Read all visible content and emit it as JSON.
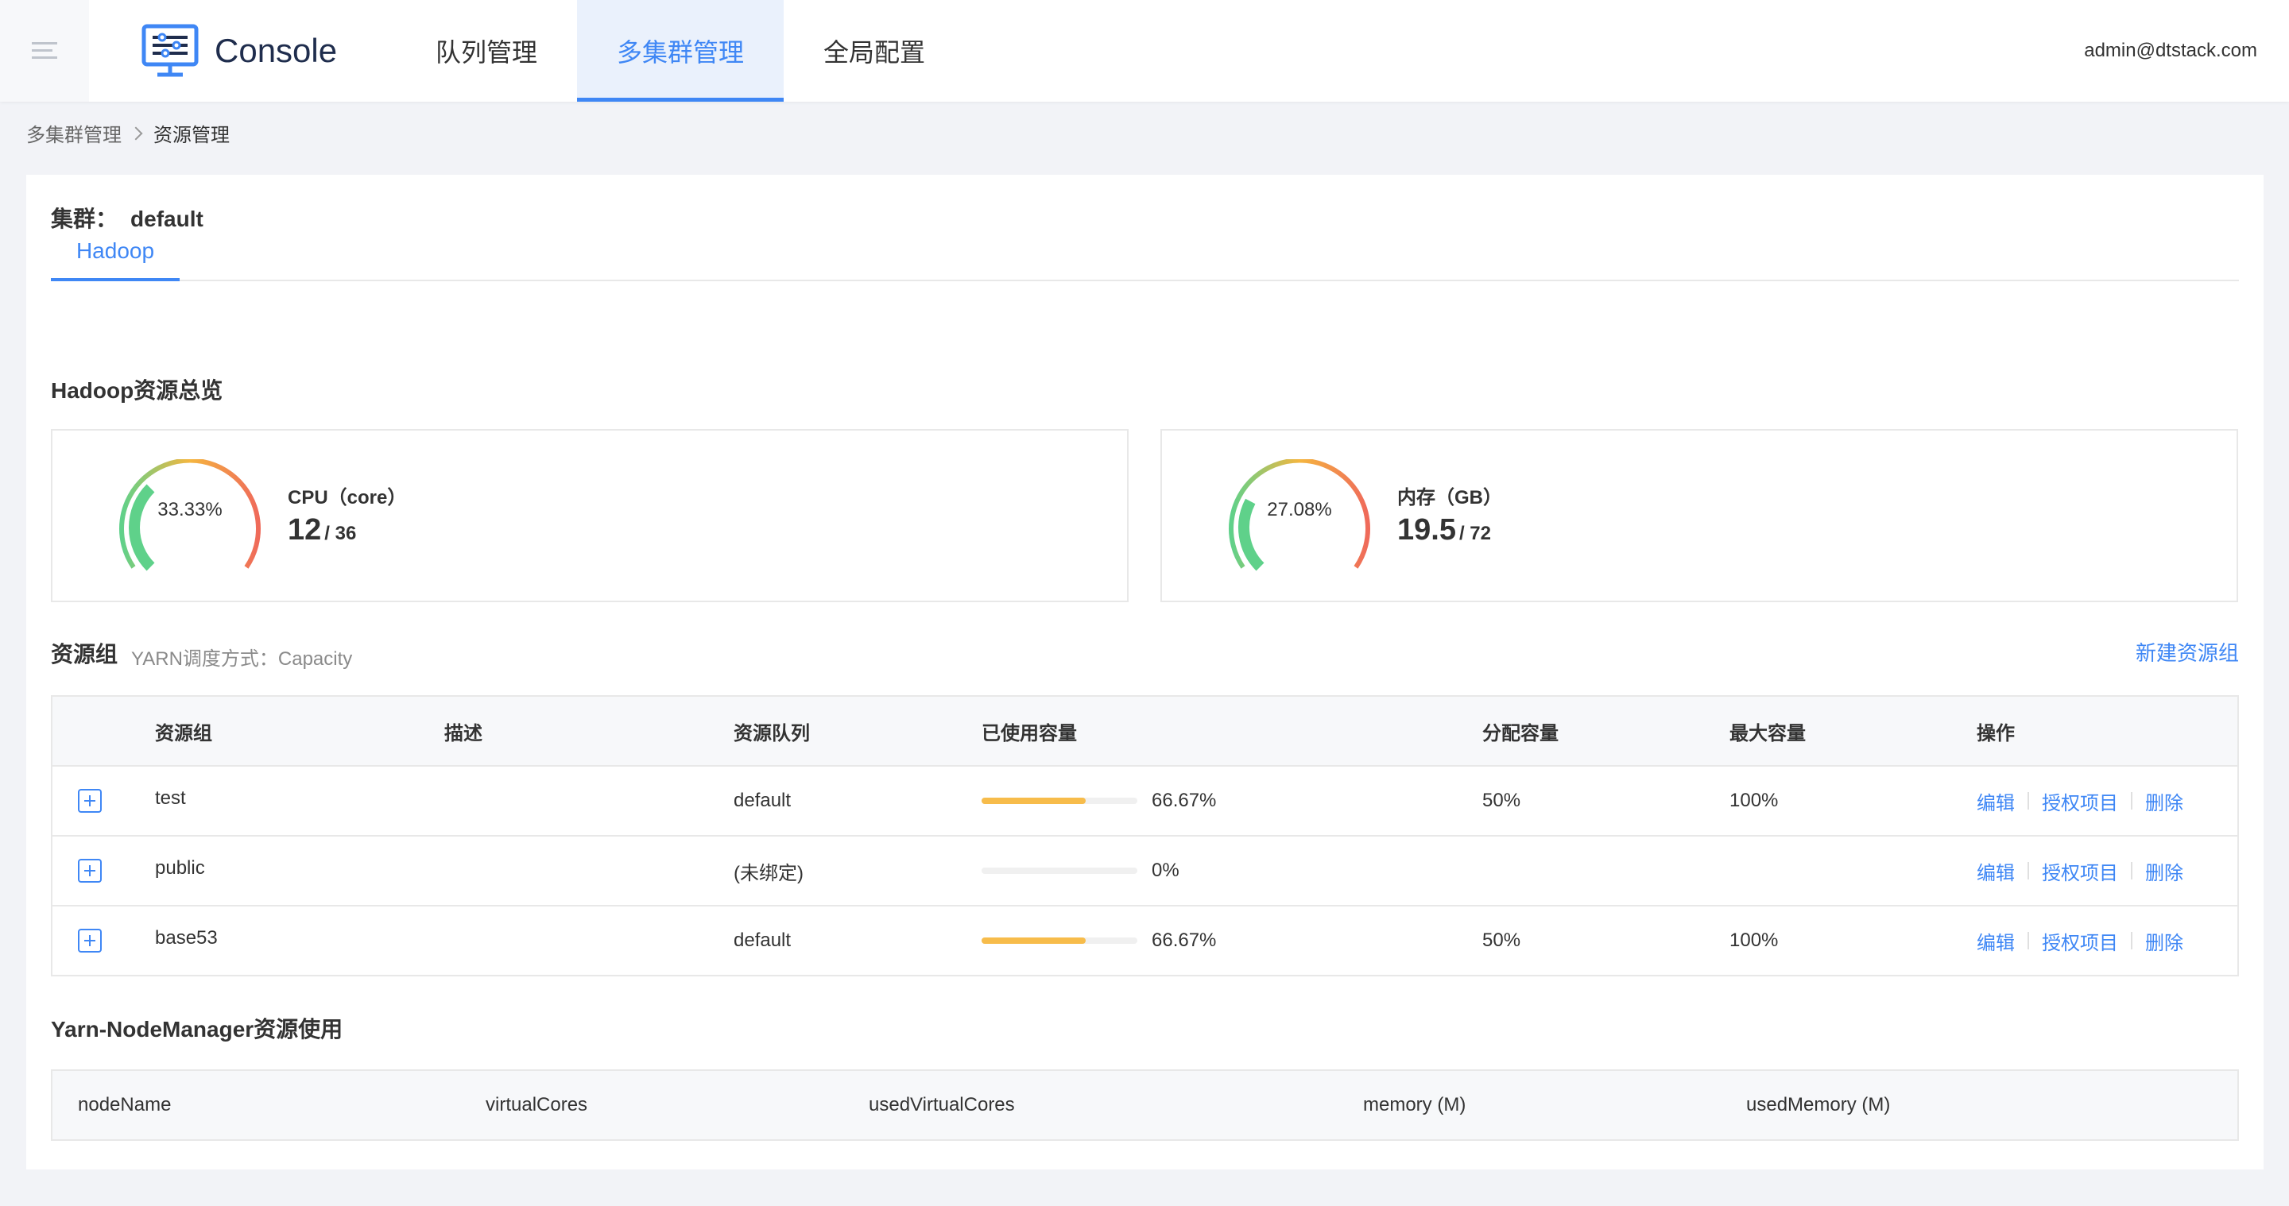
{
  "header": {
    "logo_text": "Console",
    "nav": [
      "队列管理",
      "多集群管理",
      "全局配置"
    ],
    "active_nav": 1,
    "user": "admin@dtstack.com"
  },
  "breadcrumb": {
    "parent": "多集群管理",
    "current": "资源管理"
  },
  "cluster": {
    "label": "集群：",
    "name": "default"
  },
  "tab": "Hadoop",
  "overview": {
    "title": "Hadoop资源总览",
    "cpu": {
      "label": "CPU（core）",
      "percent": "33.33%",
      "fraction": 0.3333,
      "used": "12",
      "total": "/ 36"
    },
    "memory": {
      "label": "内存（GB）",
      "percent": "27.08%",
      "fraction": 0.2708,
      "used": "19.5",
      "total": "/ 72"
    }
  },
  "resource_groups": {
    "title": "资源组",
    "subtitle": "YARN调度方式：Capacity",
    "new_button": "新建资源组",
    "columns": [
      "资源组",
      "描述",
      "资源队列",
      "已使用容量",
      "分配容量",
      "最大容量",
      "操作"
    ],
    "rows": [
      {
        "name": "test",
        "desc": "",
        "queue": "default",
        "used_pct": 66.67,
        "used": "66.67%",
        "alloc": "50%",
        "max": "100%"
      },
      {
        "name": "public",
        "desc": "",
        "queue": "(未绑定)",
        "used_pct": 0,
        "used": "0%",
        "alloc": "",
        "max": ""
      },
      {
        "name": "base53",
        "desc": "",
        "queue": "default",
        "used_pct": 66.67,
        "used": "66.67%",
        "alloc": "50%",
        "max": "100%"
      }
    ],
    "actions": [
      "编辑",
      "授权项目",
      "删除"
    ]
  },
  "node_manager": {
    "title": "Yarn-NodeManager资源使用",
    "columns": [
      "nodeName",
      "virtualCores",
      "usedVirtualCores",
      "memory (M)",
      "usedMemory (M)"
    ]
  },
  "colors": {
    "accent": "#3f87f5",
    "progress": "#f7bc4b",
    "gauge_green": "#5fd18a",
    "gauge_orange": "#f5b63f",
    "gauge_red": "#ef6a5a"
  }
}
